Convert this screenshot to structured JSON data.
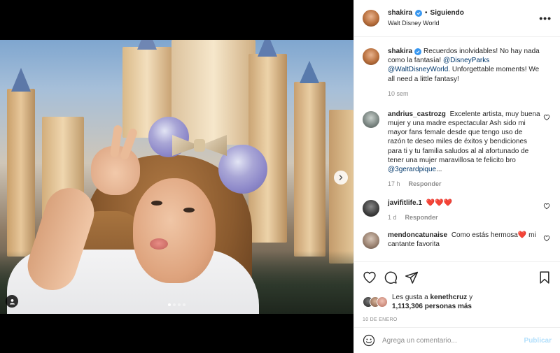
{
  "post": {
    "author": "shakira",
    "follow_status": "Siguiendo",
    "bullet": "•",
    "location": "Walt Disney World",
    "more_label": "•••"
  },
  "caption": {
    "username": "shakira",
    "text_before": "Recuerdos inolvidables! No hay nada como la fantasía!",
    "mention1": "@DisneyParks",
    "mention2": "@WaltDisneyWorld",
    "text_after": ". Unforgettable moments! We all need a little fantasy!",
    "time": "10 sem"
  },
  "comments": [
    {
      "username": "andrius_castrozg",
      "text": "Excelente artista, muy buena mujer y una madre espectacular Ash sido mi mayor fans female desde que tengo uso de razón te deseo miles de éxitos y bendiciones para ti y tu familia saludos al al afortunado de tener una mujer maravillosa te felicito bro",
      "mention": "@3gerardpique",
      "ellipsis": "...",
      "time": "17 h",
      "reply": "Responder"
    },
    {
      "username": "javifitlife.1",
      "text": "❤️❤️❤️",
      "time": "1 d",
      "reply": "Responder"
    },
    {
      "username": "mendoncatunaise",
      "text": "Como estás hermosa❤️ mi cantante favorita"
    }
  ],
  "likes": {
    "prefix": "Les gusta a",
    "user": "kenethcruz",
    "joiner": "y",
    "count": "1,113,306 personas más"
  },
  "date": "10 DE ENERO",
  "composer": {
    "placeholder": "Agrega un comentario...",
    "publish": "Publicar"
  },
  "carousel": {
    "total": 4,
    "active_index": 0
  },
  "icons": {
    "verified": "verified-badge-icon",
    "like": "heart-icon",
    "comment": "comment-bubble-icon",
    "share": "paper-plane-icon",
    "save": "bookmark-icon",
    "emoji": "smiley-icon",
    "next": "chevron-right-icon",
    "tag": "user-tag-icon"
  },
  "colors": {
    "verified": "#3897f0",
    "link": "#00376b",
    "muted": "#8e8e8e",
    "publish_disabled": "#b2dffc",
    "heart_red": "#ed4956"
  }
}
